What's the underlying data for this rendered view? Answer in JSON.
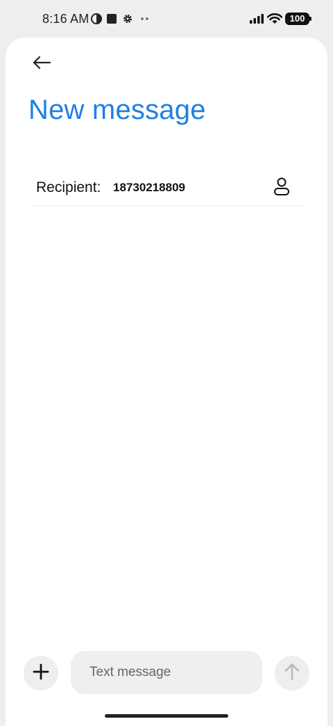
{
  "status_bar": {
    "time": "8:16 AM",
    "battery": "100",
    "icons": [
      "data-saver-icon",
      "square-notification-icon",
      "settings-gear-icon",
      "more-dots-icon",
      "signal-icon",
      "wifi-icon",
      "battery-icon"
    ]
  },
  "header": {
    "back_icon": "arrow-left-icon",
    "title": "New message"
  },
  "recipient": {
    "label": "Recipient:",
    "value": "18730218809",
    "contact_icon": "person-icon"
  },
  "composer": {
    "attach_icon": "plus-icon",
    "placeholder": "Text message",
    "send_icon": "arrow-up-icon"
  },
  "colors": {
    "accent": "#1f7fe6",
    "sheet": "#ffffff",
    "background": "#eeeeee",
    "input": "#efefef",
    "send_disabled": "#b8b8b8"
  }
}
